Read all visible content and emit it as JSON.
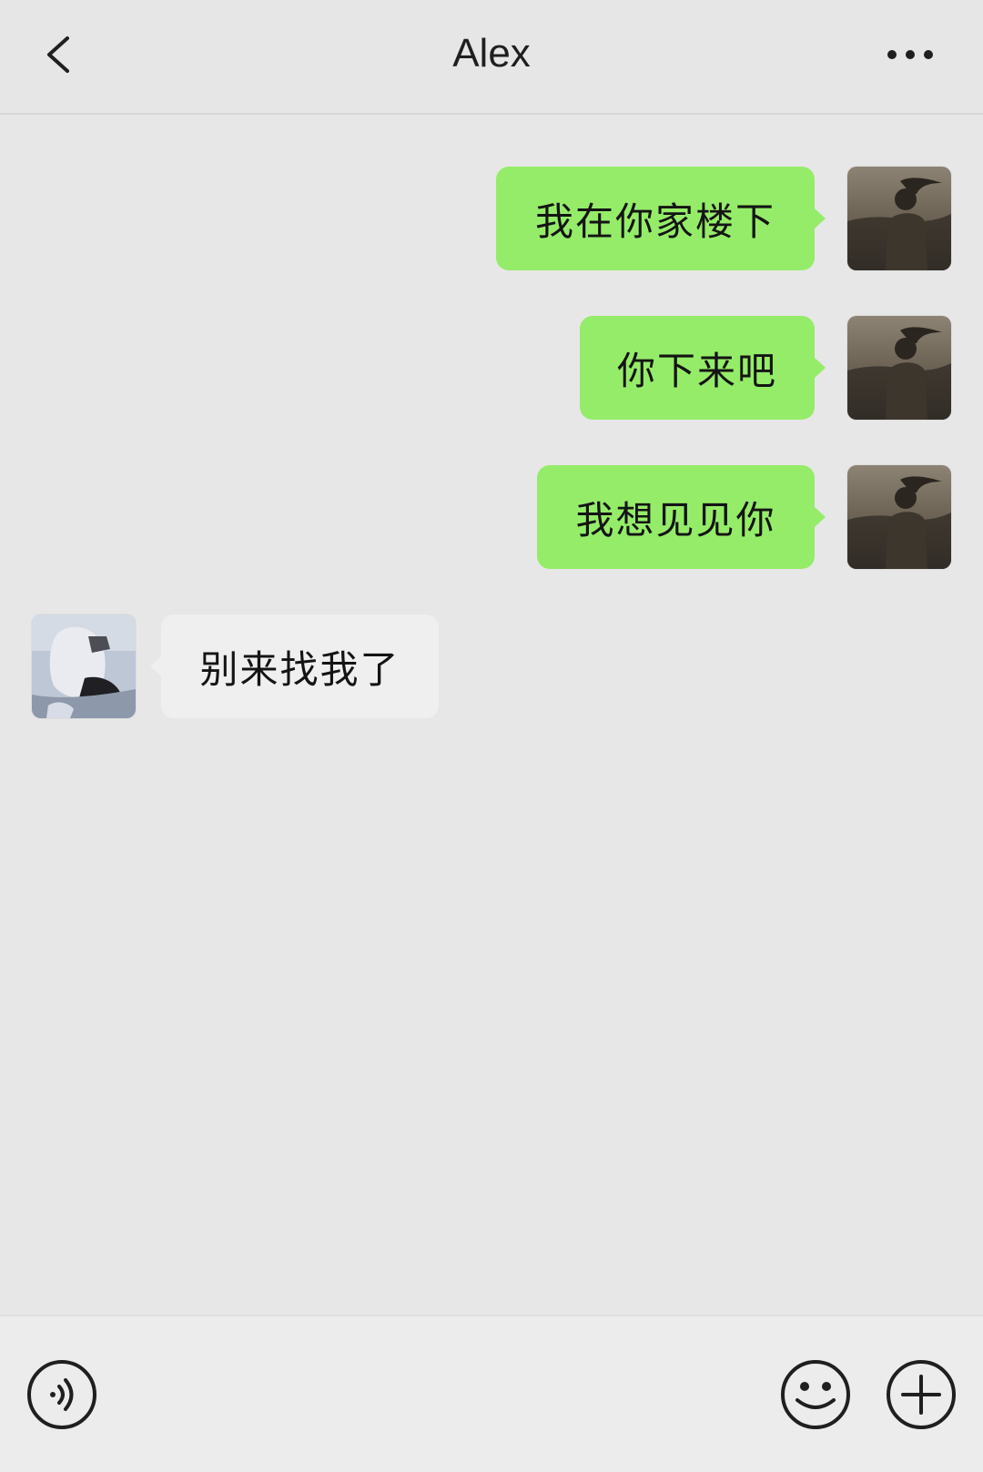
{
  "header": {
    "title": "Alex"
  },
  "messages": [
    {
      "from": "me",
      "text": "我在你家楼下"
    },
    {
      "from": "me",
      "text": "你下来吧"
    },
    {
      "from": "me",
      "text": "我想见见你"
    },
    {
      "from": "other",
      "text": "别来找我了"
    }
  ],
  "icons": {
    "back": "chevron-left-icon",
    "more": "ellipsis-icon",
    "voice": "voice-icon",
    "emoji": "emoji-icon",
    "plus": "plus-icon"
  },
  "colors": {
    "sent_bubble": "#95ec69",
    "received_bubble": "#efefef",
    "background": "#e7e7e7"
  }
}
